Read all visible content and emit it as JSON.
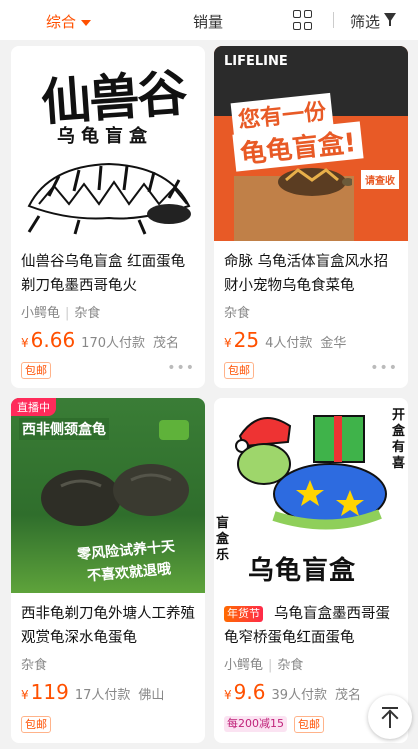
{
  "sortbar": {
    "comprehensive": "综合",
    "sales": "销量",
    "filter": "筛选",
    "accent_color": "#ff5000"
  },
  "products": [
    {
      "image_title": "仙兽谷",
      "image_subtitle": "乌龟盲盒",
      "title": "仙兽谷乌龟盲盒 红面蛋龟剃刀龟墨西哥龟火",
      "shop_tag": "小鳄龟",
      "category": "杂食",
      "currency": "¥",
      "price": "6.66",
      "paid": "170人付款",
      "city": "茂名",
      "badge": "包邮"
    },
    {
      "image_brand": "LIFELINE",
      "image_headline_1": "您有一份",
      "image_headline_2": "龟龟盲盒!",
      "image_stamp": "请查收",
      "title": "命脉 乌龟活体盲盒风水招财小宠物乌龟食菜龟",
      "category": "杂食",
      "currency": "¥",
      "price": "25",
      "paid": "4人付款",
      "city": "金华",
      "badge": "包邮"
    },
    {
      "live_label": "直播中",
      "image_title": "西非侧颈盒龟",
      "image_text_1": "零风险试养十天",
      "image_text_2": "不喜欢就退哦",
      "title": "西非龟剃刀龟外塘人工养殖观赏龟深水龟蛋龟",
      "category": "杂食",
      "currency": "¥",
      "price": "119",
      "paid": "17人付款",
      "city": "佛山",
      "badge": "包邮"
    },
    {
      "image_side_1": "开盒有喜",
      "image_side_2": "盲盒乐",
      "image_big": "乌龟盲盒",
      "promo_tag": "年货节",
      "title": "乌龟盲盒墨西哥蛋龟窄桥蛋龟红面蛋龟",
      "shop_tag": "小鳄龟",
      "category": "杂食",
      "currency": "¥",
      "price": "9.6",
      "paid": "39人付款",
      "city": "茂名",
      "discount": "每200减15",
      "badge": "包邮"
    }
  ]
}
